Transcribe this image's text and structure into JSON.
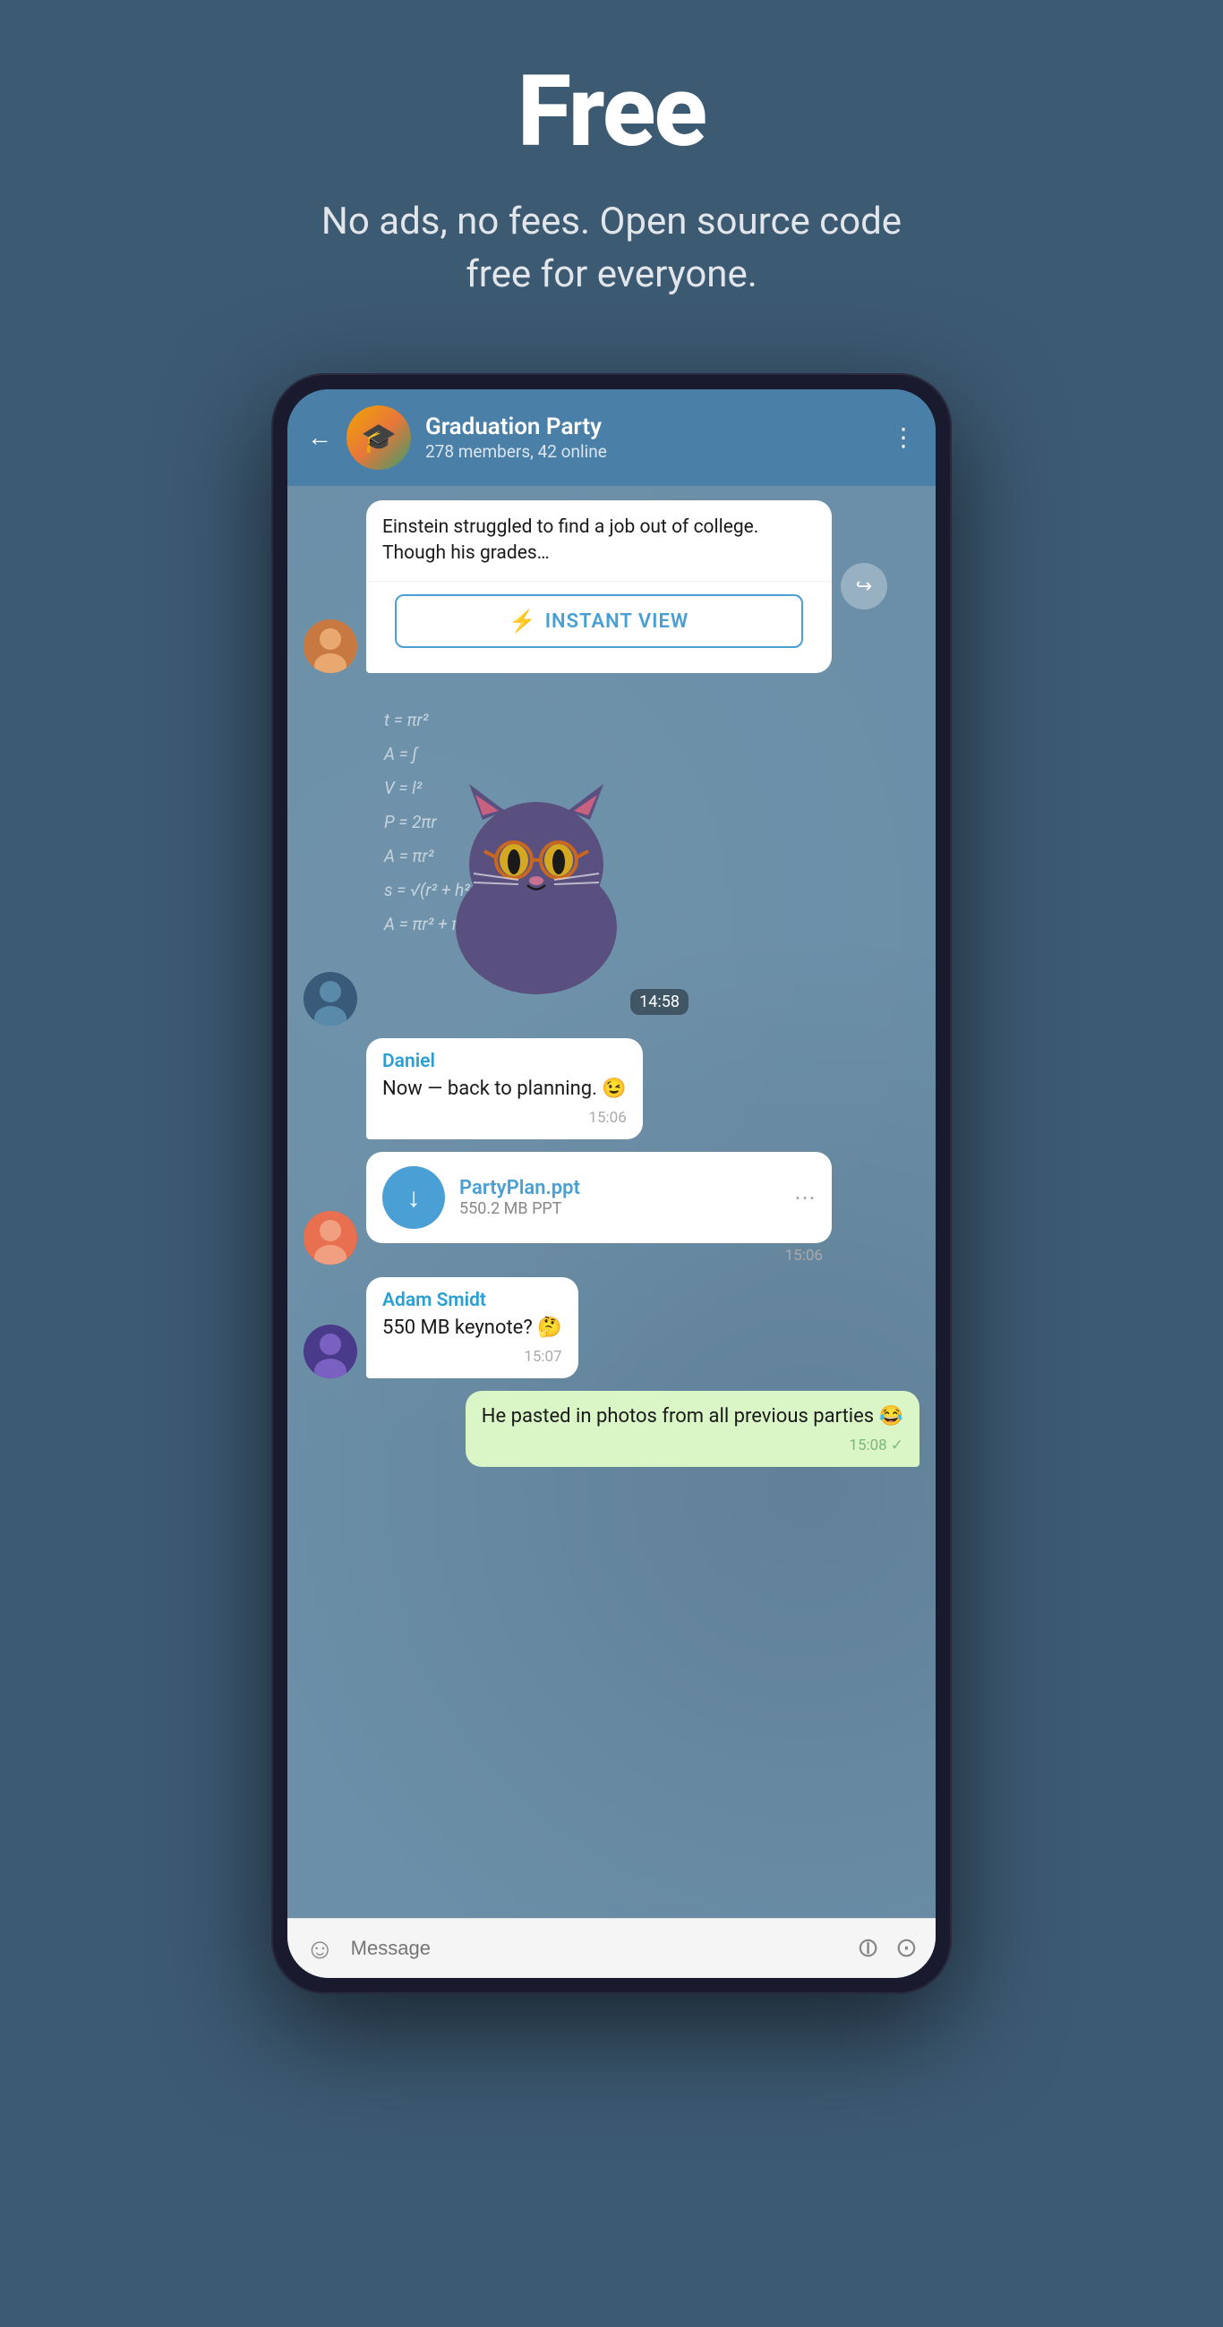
{
  "hero": {
    "title": "Free",
    "subtitle": "No ads, no fees. Open source code free for everyone."
  },
  "phone": {
    "header": {
      "back_label": "←",
      "chat_name": "Graduation Party",
      "chat_members": "278 members, 42 online",
      "more_icon": "⋮"
    },
    "messages": [
      {
        "id": "iv-message",
        "type": "instant_view",
        "article_text": "Einstein struggled to find a job out of college. Though his grades…",
        "iv_button_label": "INSTANT VIEW",
        "time": "",
        "has_forward": true
      },
      {
        "id": "sticker-message",
        "type": "sticker",
        "time": "14:58"
      },
      {
        "id": "daniel-message",
        "type": "text",
        "sender": "Daniel",
        "text": "Now — back to planning. 😉",
        "time": "15:06"
      },
      {
        "id": "file-message",
        "type": "file",
        "file_name": "PartyPlan.ppt",
        "file_size": "550.2 MB PPT",
        "time": "15:06"
      },
      {
        "id": "adam-message",
        "type": "text",
        "sender": "Adam Smidt",
        "text": "550 MB keynote? 🤔",
        "time": "15:07"
      },
      {
        "id": "own-message",
        "type": "own",
        "text": "He pasted in photos from all previous parties 😂",
        "time": "15:08",
        "check": "✓"
      }
    ],
    "input_bar": {
      "placeholder": "Message",
      "emoji_icon": "☺",
      "attach_icon": "📎",
      "camera_icon": "⊙"
    }
  },
  "colors": {
    "background": "#3d5a73",
    "header_blue": "#4a7fa8",
    "chat_bg": "#6b8fa8",
    "white": "#ffffff",
    "own_bubble": "#daf6c7",
    "iv_accent": "#4a9fd4",
    "file_accent": "#4a9fd4"
  }
}
